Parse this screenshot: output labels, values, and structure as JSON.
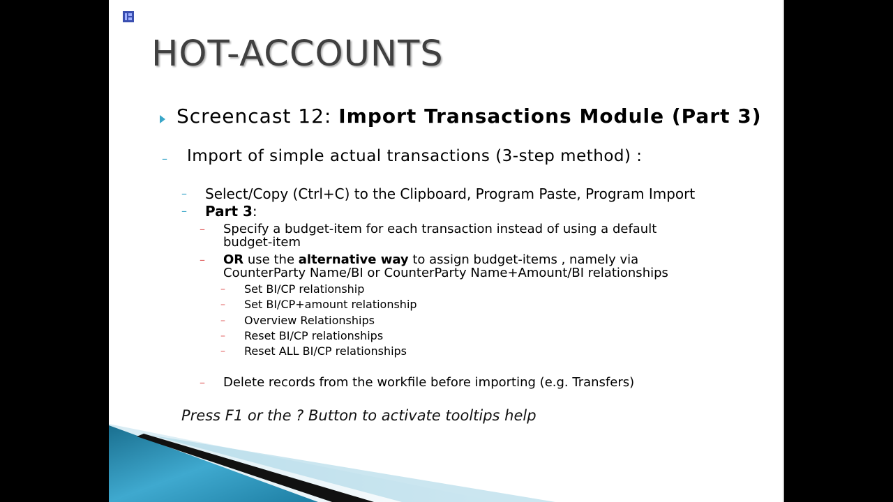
{
  "slide": {
    "title": "HOT-ACCOUNTS",
    "heading": {
      "prefix": "Screencast 12: ",
      "bold": "Import Transactions Module (Part 3)"
    },
    "subheading": "Import of simple actual transactions (3-step method) :",
    "step_line": "Select/Copy (Ctrl+C) to the Clipboard, Program Paste, Program Import",
    "part_label": "Part 3",
    "part_colon": ":",
    "item1_line1": "Specify a budget-item for each transaction instead of using a default",
    "item1_line2": "budget-item",
    "item2_or": "OR",
    "item2_mid": " use the ",
    "item2_bold": "alternative way",
    "item2_rest": " to assign budget-items , namely via",
    "item2_line2": "CounterParty Name/BI or CounterParty Name+Amount/BI relationships",
    "sub_items": [
      "Set BI/CP relationship",
      "Set BI/CP+amount relationship",
      "Overview Relationships",
      "Reset BI/CP relationships",
      "Reset ALL BI/CP relationships"
    ],
    "item3": "Delete records from the workfile before importing (e.g. Transfers)",
    "footer_note": "Press F1 or the ? Button to activate tooltips help"
  },
  "colors": {
    "accent": "#3aa6c8",
    "title_text": "#404040",
    "background_outer": "#000000",
    "slide_bg": "#ffffff"
  }
}
